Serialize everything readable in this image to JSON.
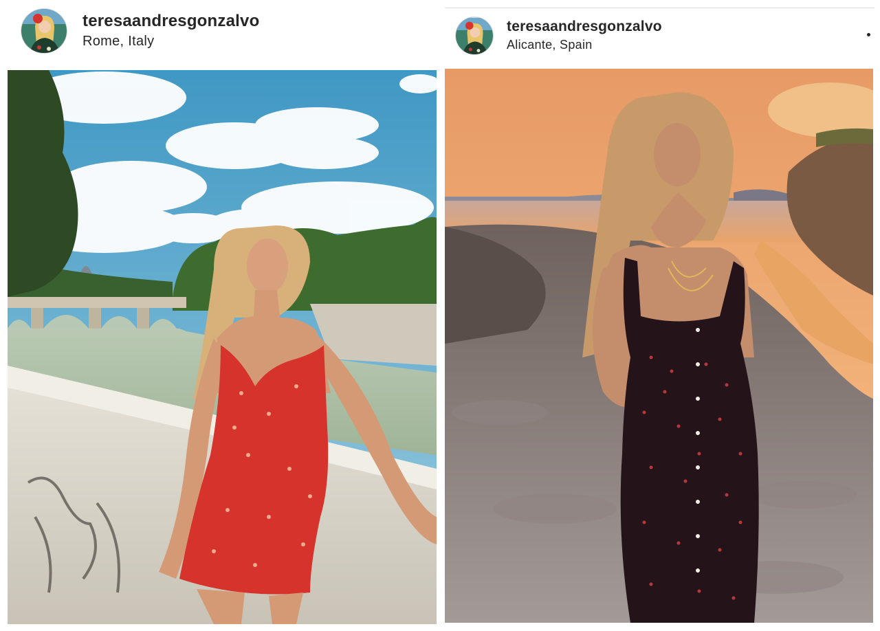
{
  "posts": [
    {
      "username": "teresaandresgonzalvo",
      "location": "Rome, Italy",
      "avatar_icon": "profile-avatar-icon",
      "photo_description_icon": "photo-rome-river-icon"
    },
    {
      "username": "teresaandresgonzalvo",
      "location": "Alicante, Spain",
      "avatar_icon": "profile-avatar-icon",
      "photo_description_icon": "photo-sunset-coast-icon",
      "more_icon": "more-options-icon"
    }
  ],
  "colors": {
    "text": "#262626",
    "divider": "#dbdbdb",
    "sky_rome": "#4b9fc6",
    "dress_red": "#d5332b",
    "sunset_orange": "#f0a86c",
    "dress_black": "#24141a"
  }
}
